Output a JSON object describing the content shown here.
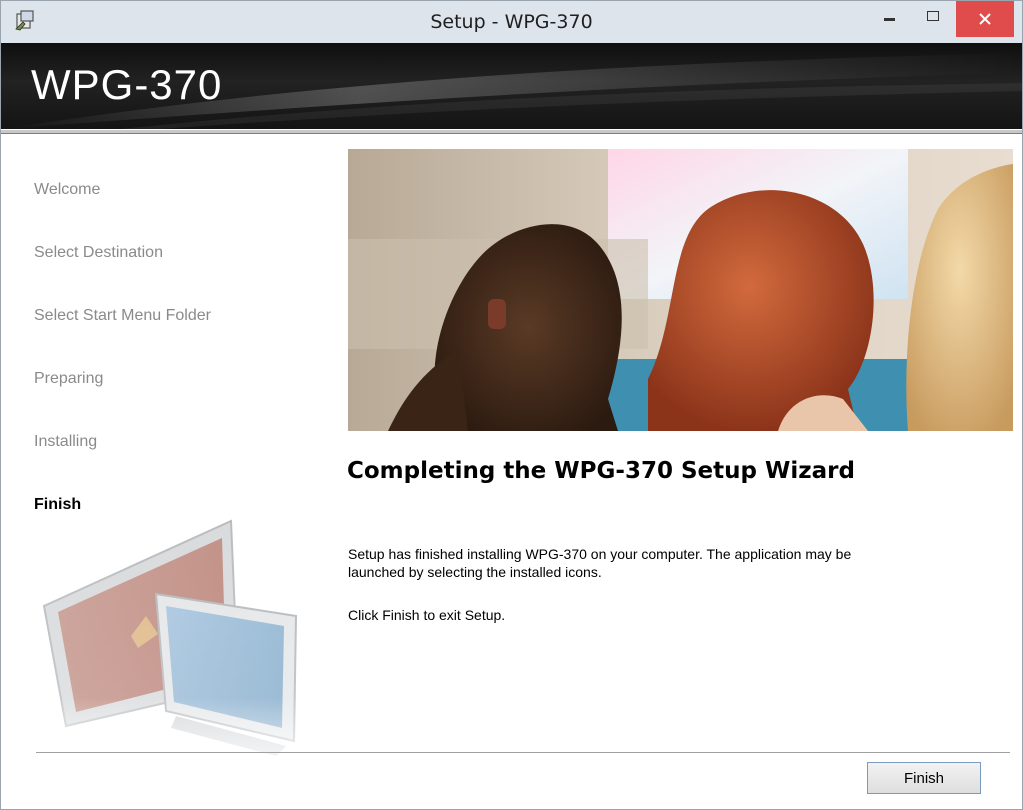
{
  "window": {
    "title": "Setup - WPG-370",
    "close_glyph": "×"
  },
  "banner": {
    "title": "WPG-370"
  },
  "steps": [
    {
      "label": "Welcome",
      "active": false
    },
    {
      "label": "Select Destination",
      "active": false
    },
    {
      "label": "Select Start Menu Folder",
      "active": false
    },
    {
      "label": "Preparing",
      "active": false
    },
    {
      "label": "Installing",
      "active": false
    },
    {
      "label": "Finish",
      "active": true
    }
  ],
  "main": {
    "heading": "Completing the WPG-370 Setup Wizard",
    "body": "Setup has finished installing WPG-370 on your computer. The application may be launched by selecting the installed icons.",
    "exit_hint": "Click Finish to exit Setup."
  },
  "footer": {
    "finish_label": "Finish"
  },
  "colors": {
    "close_button": "#e04b4b",
    "titlebar": "#dde4ec",
    "banner": "#1a1a1a"
  }
}
